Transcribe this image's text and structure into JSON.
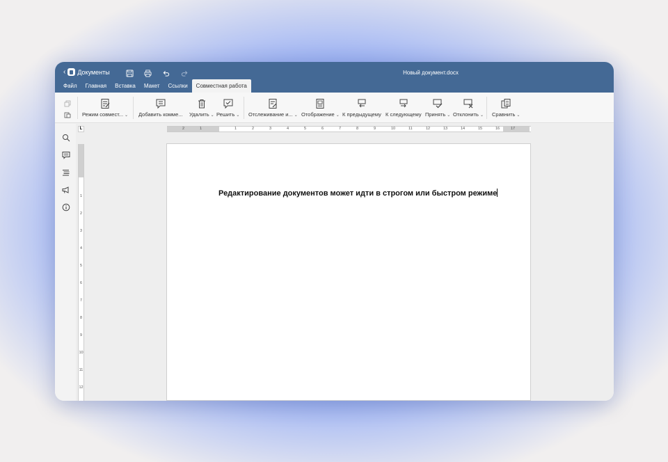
{
  "app": {
    "back_label": "Документы",
    "document_title": "Новый документ.docx"
  },
  "menu_tabs": [
    "Файл",
    "Главная",
    "Вставка",
    "Макет",
    "Ссылки",
    "Совместная работа"
  ],
  "active_tab": "Совместная работа",
  "toolbar": {
    "coedit_mode": "Режим совмест...",
    "add_comment": "Добавить комме...",
    "delete": "Удалить",
    "resolve": "Решить",
    "track_changes": "Отслеживание и...",
    "display": "Отображение",
    "previous": "К предыдущему",
    "next": "К следующему",
    "accept": "Принять",
    "reject": "Отклонить",
    "compare": "Сравнить"
  },
  "ruler": {
    "corner_label": "L",
    "h_ticks": [
      "2",
      "1",
      "1",
      "2",
      "3",
      "4",
      "5",
      "6",
      "7",
      "8",
      "9",
      "10",
      "11",
      "12",
      "13",
      "14",
      "15",
      "16",
      "17"
    ],
    "v_ticks": [
      "1",
      "2",
      "3",
      "4",
      "5",
      "6",
      "7",
      "8",
      "9",
      "10",
      "11",
      "12"
    ]
  },
  "document": {
    "body_text": "Редактирование документов может идти в строгом или быстром режиме"
  },
  "icons": {
    "left_sidebar": [
      "search-icon",
      "comment-icon",
      "navigation-icon",
      "feedback-icon",
      "info-icon"
    ]
  },
  "colors": {
    "header": "#446995",
    "background_glow": "#4a72ee"
  }
}
